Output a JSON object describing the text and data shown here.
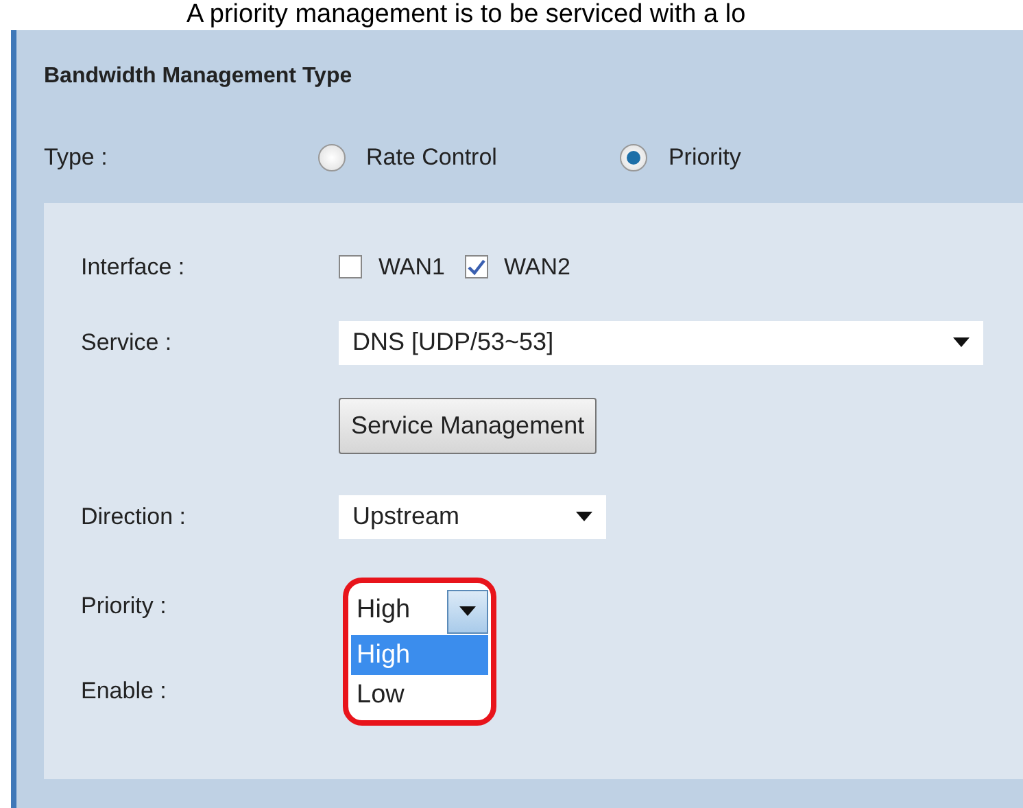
{
  "caption": "A priority management is to be serviced with a lo",
  "section": {
    "title": "Bandwidth Management Type",
    "type": {
      "label": "Type :",
      "options": [
        {
          "label": "Rate Control",
          "selected": false
        },
        {
          "label": "Priority",
          "selected": true
        }
      ]
    }
  },
  "form": {
    "interface": {
      "label": "Interface :",
      "options": [
        {
          "label": "WAN1",
          "checked": false
        },
        {
          "label": "WAN2",
          "checked": true
        }
      ]
    },
    "service": {
      "label": "Service :",
      "value": "DNS [UDP/53~53]"
    },
    "service_button": "Service Management",
    "direction": {
      "label": "Direction :",
      "value": "Upstream"
    },
    "priority": {
      "label": "Priority :",
      "value": "High",
      "expanded": true,
      "options": [
        {
          "label": "High",
          "selected": true
        },
        {
          "label": "Low",
          "selected": false
        }
      ]
    },
    "enable": {
      "label": "Enable :"
    }
  }
}
